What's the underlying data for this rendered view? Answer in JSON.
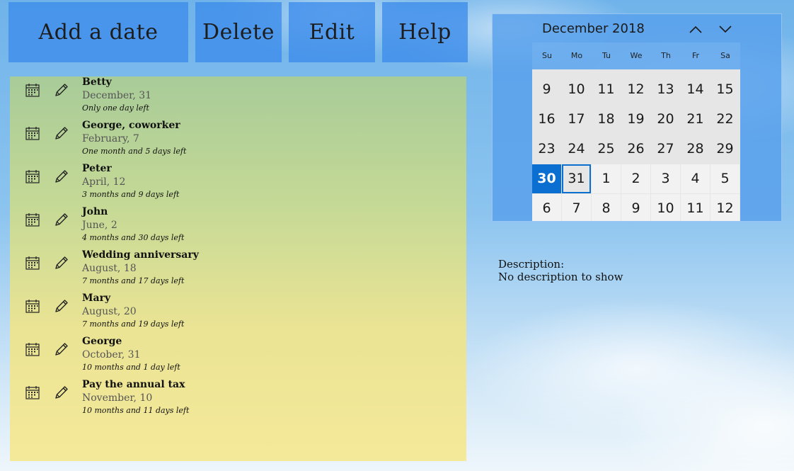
{
  "toolbar": {
    "add_label": "Add a date",
    "delete_label": "Delete",
    "edit_label": "Edit",
    "help_label": "Help"
  },
  "events": [
    {
      "name": "Betty",
      "date": "December, 31",
      "remaining": "Only one day left"
    },
    {
      "name": "George, coworker",
      "date": "February, 7",
      "remaining": "One month and 5 days left"
    },
    {
      "name": "Peter",
      "date": "April, 12",
      "remaining": "3 months and 9 days left"
    },
    {
      "name": "John",
      "date": "June, 2",
      "remaining": "4 months and 30 days left"
    },
    {
      "name": "Wedding anniversary",
      "date": "August, 18",
      "remaining": "7 months and 17 days left"
    },
    {
      "name": "Mary",
      "date": "August, 20",
      "remaining": "7 months and 19 days left"
    },
    {
      "name": "George",
      "date": "October, 31",
      "remaining": "10 months and 1 day left"
    },
    {
      "name": "Pay the annual tax",
      "date": "November, 10",
      "remaining": "10 months and 11 days left"
    }
  ],
  "calendar": {
    "title": "December 2018",
    "weekdays": [
      "Su",
      "Mo",
      "Tu",
      "We",
      "Th",
      "Fr",
      "Sa"
    ],
    "weeks": [
      [
        9,
        10,
        11,
        12,
        13,
        14,
        15
      ],
      [
        16,
        17,
        18,
        19,
        20,
        21,
        22
      ],
      [
        23,
        24,
        25,
        26,
        27,
        28,
        29
      ],
      [
        30,
        31,
        1,
        2,
        3,
        4,
        5
      ],
      [
        6,
        7,
        8,
        9,
        10,
        11,
        12
      ]
    ],
    "selected_day": 30,
    "today": 31,
    "accent_color": "#0a6fd0"
  },
  "description": {
    "label": "Description:",
    "value": "No description to show"
  }
}
